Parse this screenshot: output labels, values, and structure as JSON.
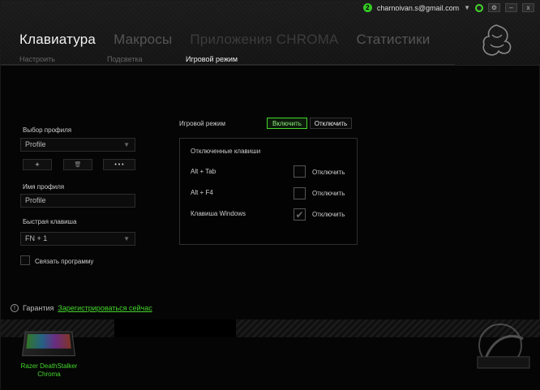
{
  "topbar": {
    "notification_count": "2",
    "email": "charnoivan.s@gmail.com",
    "settings_glyph": "⚙",
    "minimize_glyph": "–",
    "close_glyph": "x"
  },
  "tabs": [
    {
      "label": "Клавиатура",
      "state": "active"
    },
    {
      "label": "Макросы",
      "state": "inactive"
    },
    {
      "label": "Приложения CHROMA",
      "state": "dim"
    },
    {
      "label": "Статистики",
      "state": "inactive"
    }
  ],
  "subtabs": [
    {
      "label": "Настроить",
      "state": "inactive"
    },
    {
      "label": "Подсветка",
      "state": "inactive"
    },
    {
      "label": "Игровой режим",
      "state": "active"
    }
  ],
  "profile": {
    "section_label": "Выбор профиля",
    "selected": "Profile",
    "add_label": "+",
    "delete_label": "🗑",
    "more_label": "• • •",
    "name_label": "Имя профиля",
    "name_value": "Profile",
    "hotkey_label": "Быстрая клавиша",
    "hotkey_value": "FN + 1",
    "link_program_label": "Связать программу"
  },
  "game_mode": {
    "label": "Игровой режим",
    "on_label": "Включить",
    "off_label": "Отключить",
    "disabled_keys_title": "Отключенные клавиши",
    "keys": [
      {
        "name": "Alt + Tab",
        "action": "Отключить",
        "checked": false
      },
      {
        "name": "Alt + F4",
        "action": "Отключить",
        "checked": false
      },
      {
        "name": "Клавиша Windows",
        "action": "Отключить",
        "checked": true
      }
    ]
  },
  "footer": {
    "warranty_label": "Гарантия",
    "register_link": "Зарегистрироваться сейчас",
    "device_name": "Razer DeathStalker Chroma"
  },
  "colors": {
    "accent": "#44d62c",
    "background": "#050505"
  }
}
